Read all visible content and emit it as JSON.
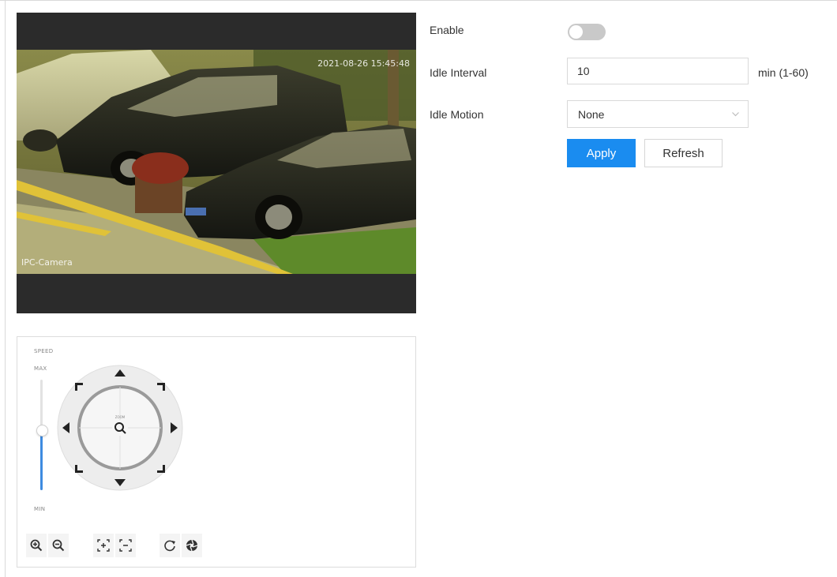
{
  "video": {
    "timestamp": "2021-08-26 15:45:48",
    "channel_name": "IPC-Camera"
  },
  "ptz": {
    "speed_label": "SPEED",
    "max_label": "MAX",
    "min_label": "MIN",
    "speed_level": 0.55,
    "center_label": "ZOOM",
    "toolbar_icons": [
      "zoom-in-icon",
      "zoom-out-icon",
      "focus-near-icon",
      "focus-far-icon",
      "iris-close-icon",
      "iris-open-icon"
    ]
  },
  "form": {
    "enable_label": "Enable",
    "enable_on": false,
    "idle_interval_label": "Idle Interval",
    "idle_interval_value": "10",
    "idle_interval_unit": "min (1-60)",
    "idle_motion_label": "Idle Motion",
    "idle_motion_value": "None",
    "apply_label": "Apply",
    "refresh_label": "Refresh"
  },
  "colors": {
    "accent": "#1a8cf0",
    "toggle_off": "#c9c9c9",
    "speed_bar": "#3e8be0"
  }
}
